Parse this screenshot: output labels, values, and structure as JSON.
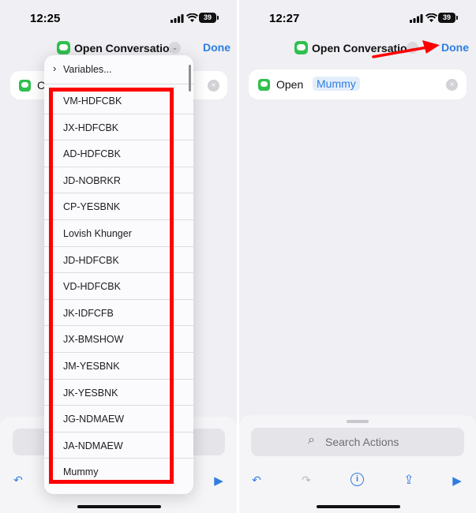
{
  "left_screen": {
    "status": {
      "time": "12:25",
      "battery": "39"
    },
    "header": {
      "title": "Open Conversation",
      "chevron": "⌄",
      "done_label": "Done"
    },
    "action_card": {
      "text": "C",
      "clear": "×"
    },
    "dropdown": {
      "variables_label": "Variables...",
      "variables_chevron": "›",
      "items": [
        "VM-HDFCBK",
        "JX-HDFCBK",
        "AD-HDFCBK",
        "JD-NOBRKR",
        "CP-YESBNK",
        "Lovish Khunger",
        "JD-HDFCBK",
        "VD-HDFCBK",
        "JK-IDFCFB",
        "JX-BMSHOW",
        "JM-YESBNK",
        "JK-YESBNK",
        "JG-NDMAEW",
        "JA-NDMAEW",
        "Mummy"
      ]
    },
    "toolbar": {
      "undo": "↶",
      "play": "▶"
    }
  },
  "right_screen": {
    "status": {
      "time": "12:27",
      "battery": "39"
    },
    "header": {
      "title": "Open Conversation",
      "chevron": "⌄",
      "done_label": "Done"
    },
    "action_card": {
      "verb": "Open",
      "variable": "Mummy",
      "clear": "×"
    },
    "search": {
      "icon": "⌕",
      "placeholder": "Search Actions"
    },
    "toolbar": {
      "undo": "↶",
      "redo": "↷",
      "info": "i",
      "share": "⇪",
      "play": "▶"
    }
  },
  "colors": {
    "accent": "#2f7ee0",
    "highlight": "#ff0000",
    "messages_green": "#30c04e"
  }
}
